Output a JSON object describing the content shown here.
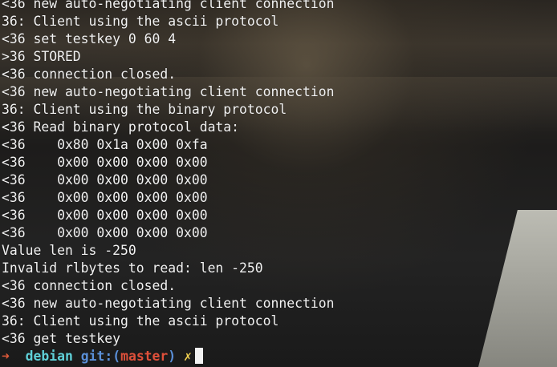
{
  "terminal": {
    "lines": [
      "<36 new auto-negotiating client connection",
      "36: Client using the ascii protocol",
      "<36 set testkey 0 60 4",
      ">36 STORED",
      "<36 connection closed.",
      "<36 new auto-negotiating client connection",
      "36: Client using the binary protocol",
      "<36 Read binary protocol data:",
      "<36    0x80 0x1a 0x00 0xfa",
      "<36    0x00 0x00 0x00 0x00",
      "<36    0x00 0x00 0x00 0x00",
      "<36    0x00 0x00 0x00 0x00",
      "<36    0x00 0x00 0x00 0x00",
      "<36    0x00 0x00 0x00 0x00",
      "Value len is -250",
      "Invalid rlbytes to read: len -250",
      "<36 connection closed.",
      "<36 new auto-negotiating client connection",
      "36: Client using the ascii protocol",
      "<36 get testkey"
    ],
    "prompt": {
      "arrow": "➜",
      "host": "debian",
      "git_label": "git:",
      "paren_open": "(",
      "branch": "master",
      "paren_close": ")",
      "dirty_mark": "✗"
    }
  },
  "colors": {
    "text": "#f2f2f2",
    "arrow": "#e05a3a",
    "host": "#5fd0d8",
    "git": "#5a8fd8",
    "branch": "#e0503a",
    "dirty": "#f0d050"
  }
}
